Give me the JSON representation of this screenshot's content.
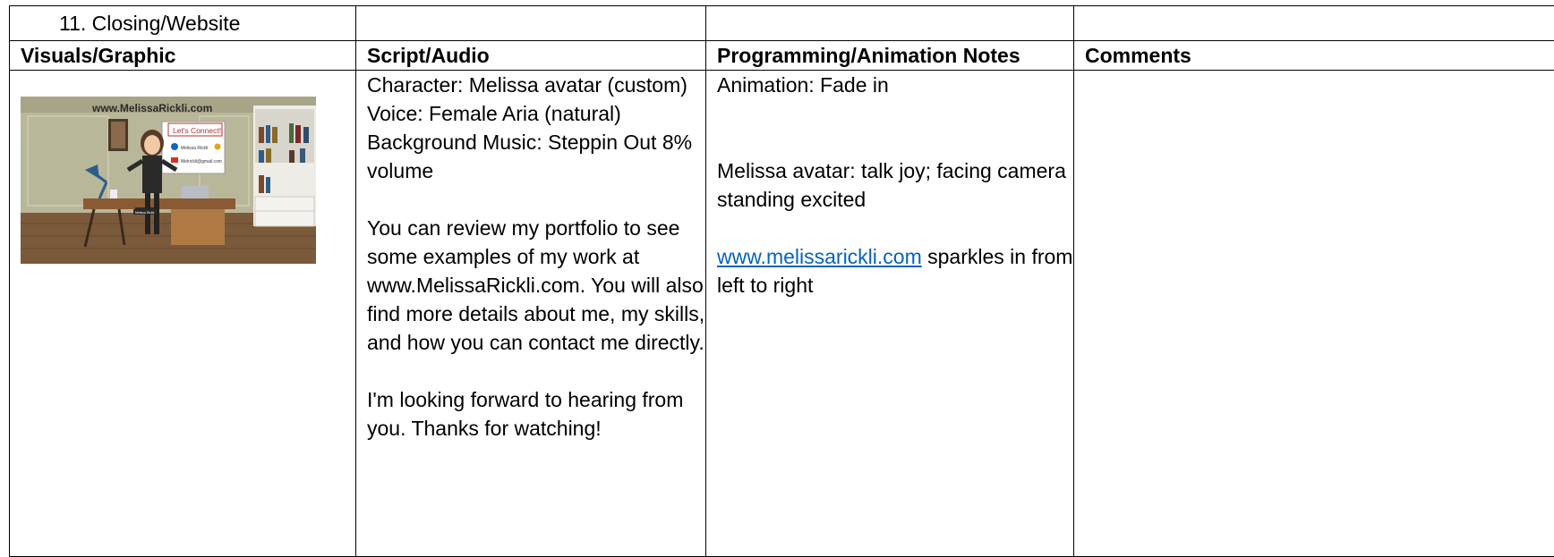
{
  "scene": {
    "label": "11. Closing/Website"
  },
  "headers": {
    "visuals": "Visuals/Graphic",
    "script": "Script/Audio",
    "programming": "Programming/Animation Notes",
    "comments": "Comments"
  },
  "thumbnail": {
    "site_title": "www.MelissaRickli.com",
    "connect_label": "Let's Connect!",
    "linkedin_name": "Melissa Rickli",
    "email": "Melrickli@gmail.com",
    "desk_sign": "Melissa Rickli"
  },
  "script": {
    "character": "Character:  Melissa avatar (custom)",
    "voice": "Voice:  Female Aria (natural)",
    "music": "Background Music: Steppin Out 8% volume",
    "para1": "You can review my portfolio to see some examples of my work at www.MelissaRickli.com.  You will also find more details about me, my skills, and how you can contact me directly.",
    "para2": "I'm looking forward to hearing from you.  Thanks for watching!"
  },
  "notes": {
    "animation": "Animation: Fade in",
    "avatar": "Melissa avatar: talk joy; facing camera standing excited",
    "link_text": "www.melissarickli.com",
    "link_rest": " sparkles in from left to right"
  },
  "colors": {
    "link": "#0563C1",
    "border": "#000000"
  }
}
